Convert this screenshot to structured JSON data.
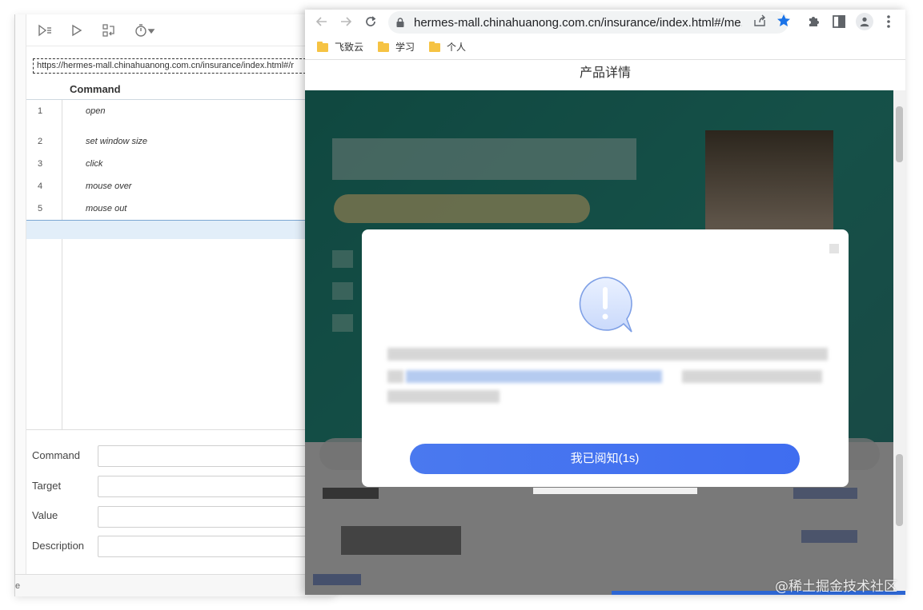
{
  "ide": {
    "base_url": "https://hermes-mall.chinahuanong.com.cn/insurance/index.html#/r",
    "column_header": "Command",
    "commands": [
      {
        "num": "1",
        "command": "open"
      },
      {
        "num": "2",
        "command": "set window size"
      },
      {
        "num": "3",
        "command": "click"
      },
      {
        "num": "4",
        "command": "mouse over"
      },
      {
        "num": "5",
        "command": "mouse out"
      }
    ],
    "fields": {
      "command_label": "Command",
      "target_label": "Target",
      "value_label": "Value",
      "description_label": "Description"
    },
    "status_fragment": "e"
  },
  "browser": {
    "url": "hermes-mall.chinahuanong.com.cn/insurance/index.html#/me...",
    "bookmarks": [
      "飞致云",
      "学习",
      "个人"
    ],
    "page_title": "产品详情",
    "modal_button": "我已阅知(1s)"
  },
  "watermark": "@稀土掘金技术社区",
  "colors": {
    "accent": "#1a73e8",
    "modal_button": "#4a79ef",
    "banner": "#2a9a8a",
    "selection": "#e2eef9"
  }
}
